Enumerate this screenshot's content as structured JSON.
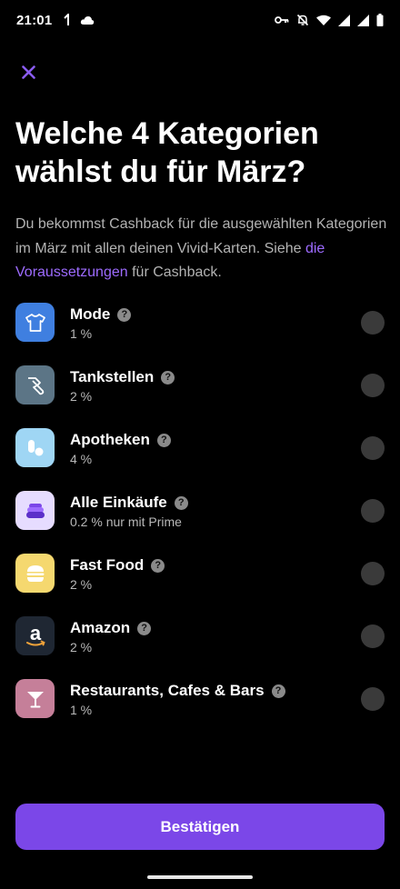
{
  "status_bar": {
    "time": "21:01"
  },
  "header": {
    "title": "Welche 4 Kategorien wählst du für März?",
    "description_before": "Du bekommst Cashback für die ausgewählten Kategorien im März mit allen deinen Vivid-Karten. Siehe ",
    "description_link": "die Voraussetzungen",
    "description_after": " für Cashback."
  },
  "categories": [
    {
      "name": "Mode",
      "rate": "1 %",
      "icon": "tshirt-icon",
      "color": "#3f7fe0"
    },
    {
      "name": "Tankstellen",
      "rate": "2 %",
      "icon": "fuel-nozzle-icon",
      "color": "#5c7586"
    },
    {
      "name": "Apotheken",
      "rate": "4 %",
      "icon": "pills-icon",
      "color": "#9fd6f4"
    },
    {
      "name": "Alle Einkäufe",
      "rate": "0.2 % nur mit Prime",
      "icon": "cards-stack-icon",
      "color": "#e6dcff"
    },
    {
      "name": "Fast Food",
      "rate": "2 %",
      "icon": "burger-icon",
      "color": "#f5d86f"
    },
    {
      "name": "Amazon",
      "rate": "2 %",
      "icon": "amazon-logo-icon",
      "color": "#1f2733"
    },
    {
      "name": "Restaurants, Cafes & Bars",
      "rate": "1 %",
      "icon": "cocktail-glass-icon",
      "color": "#c57f99"
    }
  ],
  "help_glyph": "?",
  "confirm_label": "Bestätigen",
  "colors": {
    "background": "#000000",
    "accent": "#7b47e8",
    "link": "#9d6bff"
  }
}
